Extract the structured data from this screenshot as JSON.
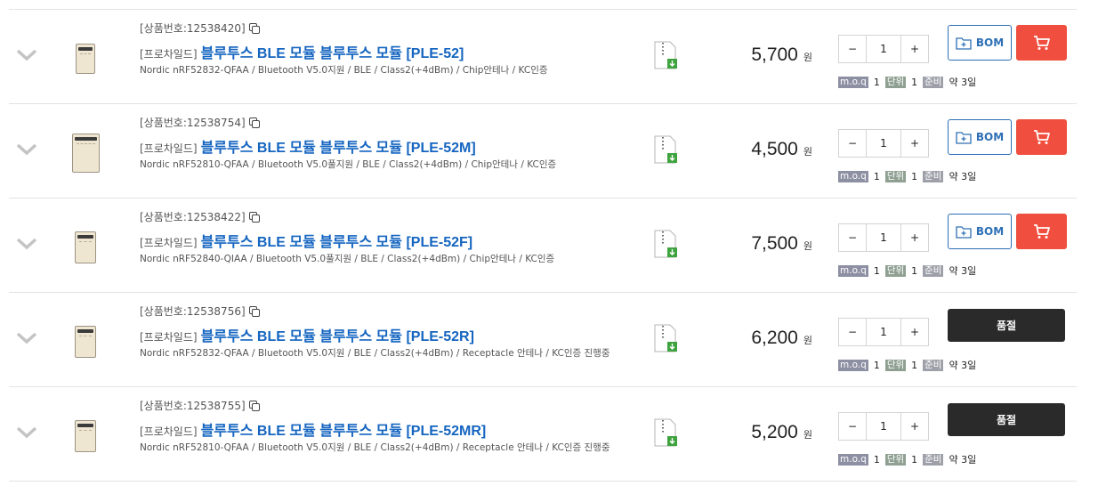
{
  "products": [
    {
      "product_no": "[상품번호:12538420]",
      "maker": "[프로차일드]",
      "name": "블루투스 BLE 모듈 블루투스 모듈 [PLE-52]",
      "desc": "Nordic nRF52832-QFAA / Bluetooth V5.0지원 / BLE / Class2(+4dBm) / Chip안테나 / KC인증",
      "price": "5,700",
      "currency": "원",
      "qty": "1",
      "moq_label": "m.o.q",
      "moq": "1",
      "unit_label": "단위",
      "unit": "1",
      "ready_label": "준비",
      "ready": "약 3일",
      "status": "bom",
      "bom_label": "BOM"
    },
    {
      "product_no": "[상품번호:12538754]",
      "maker": "[프로차일드]",
      "name": "블루투스 BLE 모듈 블루투스 모듈 [PLE-52M]",
      "desc": "Nordic nRF52810-QFAA / Bluetooth V5.0풀지원 / BLE / Class2(+4dBm) / Chip안테나 / KC인증",
      "price": "4,500",
      "currency": "원",
      "qty": "1",
      "moq_label": "m.o.q",
      "moq": "1",
      "unit_label": "단위",
      "unit": "1",
      "ready_label": "준비",
      "ready": "약 3일",
      "status": "bom",
      "bom_label": "BOM"
    },
    {
      "product_no": "[상품번호:12538422]",
      "maker": "[프로차일드]",
      "name": "블루투스 BLE 모듈 블루투스 모듈 [PLE-52F]",
      "desc": "Nordic nRF52840-QIAA / Bluetooth V5.0풀지원 / BLE / Class2(+4dBm) / Chip안테나 / KC인증",
      "price": "7,500",
      "currency": "원",
      "qty": "1",
      "moq_label": "m.o.q",
      "moq": "1",
      "unit_label": "단위",
      "unit": "1",
      "ready_label": "준비",
      "ready": "약 3일",
      "status": "bom",
      "bom_label": "BOM"
    },
    {
      "product_no": "[상품번호:12538756]",
      "maker": "[프로차일드]",
      "name": "블루투스 BLE 모듈 블루투스 모듈 [PLE-52R]",
      "desc": "Nordic nRF52832-QFAA / Bluetooth V5.0지원 / BLE / Class2(+4dBm) / Receptacle 안테나 / KC인증 진행중",
      "price": "6,200",
      "currency": "원",
      "qty": "1",
      "moq_label": "m.o.q",
      "moq": "1",
      "unit_label": "단위",
      "unit": "1",
      "ready_label": "준비",
      "ready": "약 3일",
      "status": "soldout",
      "soldout_label": "품절"
    },
    {
      "product_no": "[상품번호:12538755]",
      "maker": "[프로차일드]",
      "name": "블루투스 BLE 모듈 블루투스 모듈 [PLE-52MR]",
      "desc": "Nordic nRF52810-QFAA / Bluetooth V5.0지원 / BLE / Class2(+4dBm) / Receptacle 안테나 / KC인증 진행중",
      "price": "5,200",
      "currency": "원",
      "qty": "1",
      "moq_label": "m.o.q",
      "moq": "1",
      "unit_label": "단위",
      "unit": "1",
      "ready_label": "준비",
      "ready": "약 3일",
      "status": "soldout",
      "soldout_label": "품절"
    }
  ],
  "stepper": {
    "minus": "−",
    "plus": "+"
  },
  "colors": {
    "link_blue": "#1565c0",
    "cart_red": "#f04e3e",
    "soldout_dark": "#2a2a2a",
    "bom_blue": "#2d6fb5"
  },
  "icons": [
    "chevron-down-icon",
    "copy-icon",
    "zip-file-download-icon",
    "bom-add-icon",
    "cart-icon"
  ]
}
